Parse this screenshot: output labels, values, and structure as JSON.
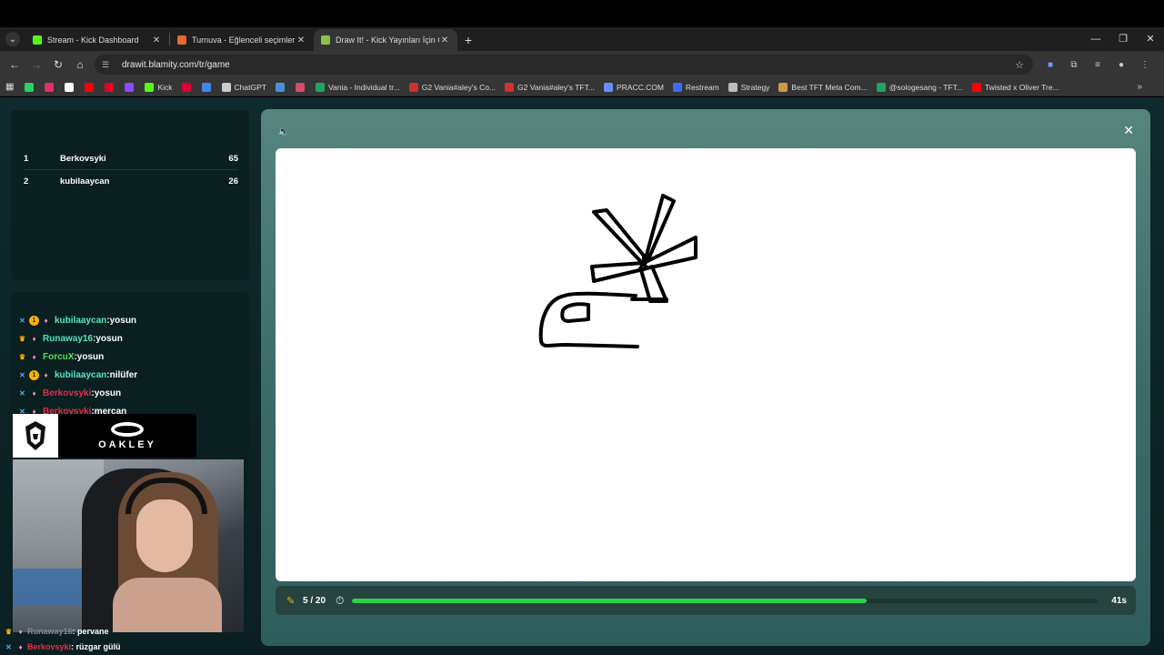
{
  "browser": {
    "tabs": [
      {
        "title": "Stream - Kick Dashboard",
        "color": "#53fc18"
      },
      {
        "title": "Turnuva - Eğlenceli seçimler yap",
        "color": "#e26b2f"
      },
      {
        "title": "Draw It! - Kick Yayınları İçin Çiz",
        "color": "#8bc34a"
      }
    ],
    "url": "drawit.blamity.com/tr/game",
    "bookmarks": [
      {
        "label": "",
        "color": "#25d366"
      },
      {
        "label": "",
        "color": "#e1306c"
      },
      {
        "label": "",
        "color": "#ffffff"
      },
      {
        "label": "",
        "color": "#ff0000"
      },
      {
        "label": "",
        "color": "#e60023"
      },
      {
        "label": "",
        "color": "#9146ff"
      },
      {
        "label": "Kick",
        "color": "#53fc18"
      },
      {
        "label": "",
        "color": "#e00034"
      },
      {
        "label": "",
        "color": "#4285f4"
      },
      {
        "label": "ChatGPT",
        "color": "#cccccc"
      },
      {
        "label": "",
        "color": "#4a90d9"
      },
      {
        "label": "",
        "color": "#d84b6b"
      },
      {
        "label": "Vania - Individual tr...",
        "color": "#21a366"
      },
      {
        "label": "G2 Vania#aley's Co...",
        "color": "#d03030"
      },
      {
        "label": "G2 Vania#aley's TFT...",
        "color": "#d03030"
      },
      {
        "label": "PRACC.COM",
        "color": "#6a8cff"
      },
      {
        "label": "Restream",
        "color": "#3d6cf2"
      },
      {
        "label": "Strategy",
        "color": "#bbbbbb"
      },
      {
        "label": "Best TFT Meta Com...",
        "color": "#c99a4a"
      },
      {
        "label": "@sologesang - TFT...",
        "color": "#21a366"
      },
      {
        "label": "Twisted x Oliver Tre...",
        "color": "#ff0000"
      }
    ]
  },
  "leaderboard": [
    {
      "rank": "1",
      "name": "Berkovsyki",
      "points": "65"
    },
    {
      "rank": "2",
      "name": "kubilaaycan",
      "points": "26"
    }
  ],
  "chat": [
    {
      "badges": [
        "sword",
        "one",
        "pin"
      ],
      "user": "kubilaaycan",
      "color": "teal",
      "message": ":yosun"
    },
    {
      "badges": [
        "crown",
        "pin"
      ],
      "user": "Runaway16",
      "color": "teal",
      "message": ":yosun"
    },
    {
      "badges": [
        "crown",
        "pin"
      ],
      "user": "ForcuX",
      "color": "green",
      "message": ":yosun"
    },
    {
      "badges": [
        "sword",
        "one",
        "pin"
      ],
      "user": "kubilaaycan",
      "color": "teal",
      "message": ":nilüfer"
    },
    {
      "badges": [
        "sword",
        "pin"
      ],
      "user": "Berkovsyki",
      "color": "red",
      "message": ":yosun"
    },
    {
      "badges": [
        "sword",
        "pin"
      ],
      "user": "Berkovsyki",
      "color": "red",
      "message": ":mercan"
    }
  ],
  "sponsor": {
    "brand": "OAKLEY"
  },
  "bottom_chat": [
    {
      "user": "Runaway16",
      "message": ": pervane",
      "color": "#8a8a8a"
    },
    {
      "user": "Berkovsyki",
      "message": ": rüzgar gülü",
      "color": "#e0304a"
    }
  ],
  "game": {
    "round": "5 / 20",
    "progress": 0.69,
    "seconds": "41s"
  }
}
